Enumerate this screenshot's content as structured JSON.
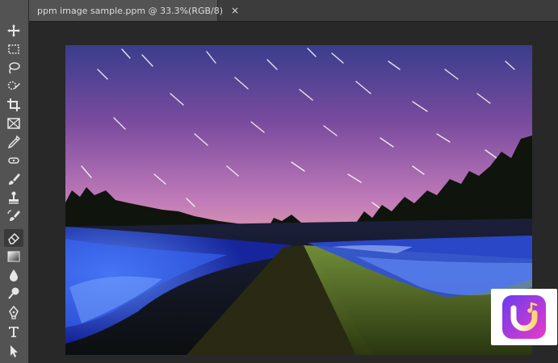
{
  "document_tab": {
    "label": "ppm image sample.ppm @ 33.3%(RGB/8)",
    "close_glyph": "×"
  },
  "tools": [
    {
      "name": "move-tool-icon"
    },
    {
      "name": "marquee-tool-icon"
    },
    {
      "name": "lasso-tool-icon"
    },
    {
      "name": "quick-selection-tool-icon"
    },
    {
      "name": "crop-tool-icon"
    },
    {
      "name": "frame-tool-icon"
    },
    {
      "name": "eyedropper-tool-icon"
    },
    {
      "name": "spot-healing-tool-icon"
    },
    {
      "name": "brush-tool-icon"
    },
    {
      "name": "clone-stamp-tool-icon"
    },
    {
      "name": "history-brush-tool-icon"
    },
    {
      "name": "eraser-tool-icon"
    },
    {
      "name": "gradient-tool-icon"
    },
    {
      "name": "blur-tool-icon"
    },
    {
      "name": "dodge-tool-icon"
    },
    {
      "name": "pen-tool-icon"
    },
    {
      "name": "type-tool-icon"
    },
    {
      "name": "path-selection-tool-icon"
    }
  ],
  "colors": {
    "toolbar_bg": "#535353",
    "canvas_bg": "#282828",
    "badge_gradient_start": "#6a3cf0",
    "badge_gradient_end": "#e83ac8"
  }
}
